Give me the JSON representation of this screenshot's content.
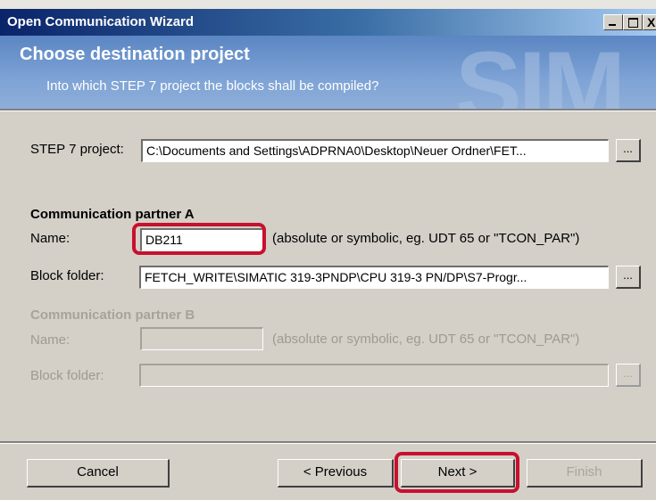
{
  "window": {
    "title": "Open Communication Wizard",
    "controls": {
      "minimize": "_",
      "maximize": "□",
      "close": "X"
    }
  },
  "header": {
    "title": "Choose destination project",
    "subtitle": "Into which STEP 7 project the blocks shall be compiled?",
    "watermark": "SIM"
  },
  "project": {
    "label": "STEP 7 project:",
    "value": "C:\\Documents and Settings\\ADPRNA0\\Desktop\\Neuer Ordner\\FET...",
    "browse": "..."
  },
  "partner_a": {
    "heading": "Communication partner A",
    "name_label": "Name:",
    "name_value": "DB211",
    "name_hint": "(absolute or symbolic, eg. UDT 65 or \"TCON_PAR\")",
    "folder_label": "Block folder:",
    "folder_value": "FETCH_WRITE\\SIMATIC 319-3PNDP\\CPU 319-3 PN/DP\\S7-Progr...",
    "browse": "..."
  },
  "partner_b": {
    "heading": "Communication partner B",
    "name_label": "Name:",
    "name_value": "",
    "name_hint": "(absolute or symbolic, eg. UDT 65 or \"TCON_PAR\")",
    "folder_label": "Block folder:",
    "folder_value": "",
    "browse": "..."
  },
  "buttons": {
    "cancel": "Cancel",
    "previous": "< Previous",
    "next": "Next >",
    "finish": "Finish"
  },
  "colors": {
    "highlight": "#c8102e",
    "header_blue": "#7ea3d6",
    "title_blue": "#0a246a"
  }
}
